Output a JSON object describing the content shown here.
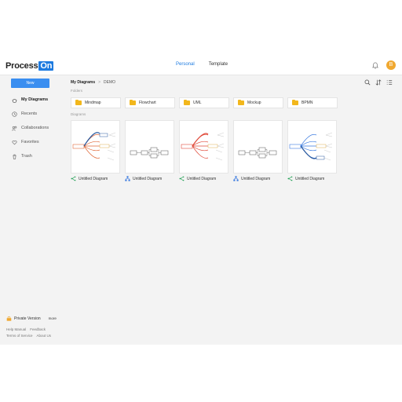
{
  "header": {
    "logo_text": "Process",
    "logo_badge": "On",
    "tabs": [
      {
        "label": "Personal",
        "active": true
      },
      {
        "label": "Template",
        "active": false
      }
    ],
    "avatar_letter": "B",
    "brand_color": "#1e7be0"
  },
  "sidebar": {
    "new_label": "New",
    "items": [
      {
        "label": "My Diagrams",
        "icon": "diagrams-icon",
        "active": true
      },
      {
        "label": "Recents",
        "icon": "clock-icon"
      },
      {
        "label": "Collaborations",
        "icon": "people-icon"
      },
      {
        "label": "Favorites",
        "icon": "heart-icon"
      },
      {
        "label": "Trash",
        "icon": "trash-icon"
      }
    ],
    "private_label": "Private Version",
    "more_label": "more",
    "links": [
      "Help Manual",
      "Feedback",
      "Terms of Service",
      "About Us"
    ]
  },
  "main": {
    "breadcrumb": {
      "root": "My Diagrams",
      "sep": ">",
      "current": "DEMO"
    },
    "folders_title": "Folders",
    "folders": [
      "Mindmap",
      "Flowchart",
      "UML",
      "Mockup",
      "BPMN"
    ],
    "diagrams_title": "Diagrams",
    "diagrams": [
      {
        "title": "Untitled Diagram",
        "kind": "mindmap",
        "accent": "#e06a3a"
      },
      {
        "title": "Untitled Diagram",
        "kind": "flowchart"
      },
      {
        "title": "Untitled Diagram",
        "kind": "mindmap",
        "accent": "#e04a3a"
      },
      {
        "title": "Untitled Diagram",
        "kind": "flowchart"
      },
      {
        "title": "Untitled Diagram",
        "kind": "mindmap",
        "accent": "#3a7ae0"
      }
    ]
  }
}
